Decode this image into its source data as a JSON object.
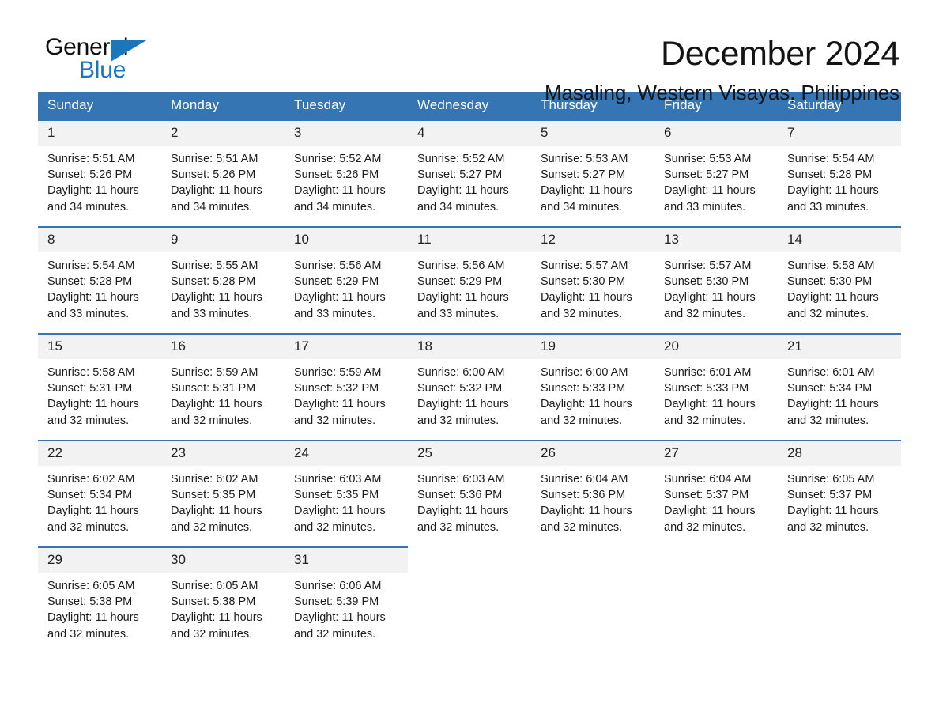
{
  "brand": {
    "name_part1": "General",
    "name_part2": "Blue",
    "triangle_color": "#1b76bc",
    "accent_color": "#3575b4"
  },
  "header": {
    "month_title": "December 2024",
    "location": "Masaling, Western Visayas, Philippines"
  },
  "calendar": {
    "weekday_headers": [
      "Sunday",
      "Monday",
      "Tuesday",
      "Wednesday",
      "Thursday",
      "Friday",
      "Saturday"
    ],
    "weeks": [
      [
        {
          "day": "1",
          "sunrise": "Sunrise: 5:51 AM",
          "sunset": "Sunset: 5:26 PM",
          "daylight": "Daylight: 11 hours and 34 minutes."
        },
        {
          "day": "2",
          "sunrise": "Sunrise: 5:51 AM",
          "sunset": "Sunset: 5:26 PM",
          "daylight": "Daylight: 11 hours and 34 minutes."
        },
        {
          "day": "3",
          "sunrise": "Sunrise: 5:52 AM",
          "sunset": "Sunset: 5:26 PM",
          "daylight": "Daylight: 11 hours and 34 minutes."
        },
        {
          "day": "4",
          "sunrise": "Sunrise: 5:52 AM",
          "sunset": "Sunset: 5:27 PM",
          "daylight": "Daylight: 11 hours and 34 minutes."
        },
        {
          "day": "5",
          "sunrise": "Sunrise: 5:53 AM",
          "sunset": "Sunset: 5:27 PM",
          "daylight": "Daylight: 11 hours and 34 minutes."
        },
        {
          "day": "6",
          "sunrise": "Sunrise: 5:53 AM",
          "sunset": "Sunset: 5:27 PM",
          "daylight": "Daylight: 11 hours and 33 minutes."
        },
        {
          "day": "7",
          "sunrise": "Sunrise: 5:54 AM",
          "sunset": "Sunset: 5:28 PM",
          "daylight": "Daylight: 11 hours and 33 minutes."
        }
      ],
      [
        {
          "day": "8",
          "sunrise": "Sunrise: 5:54 AM",
          "sunset": "Sunset: 5:28 PM",
          "daylight": "Daylight: 11 hours and 33 minutes."
        },
        {
          "day": "9",
          "sunrise": "Sunrise: 5:55 AM",
          "sunset": "Sunset: 5:28 PM",
          "daylight": "Daylight: 11 hours and 33 minutes."
        },
        {
          "day": "10",
          "sunrise": "Sunrise: 5:56 AM",
          "sunset": "Sunset: 5:29 PM",
          "daylight": "Daylight: 11 hours and 33 minutes."
        },
        {
          "day": "11",
          "sunrise": "Sunrise: 5:56 AM",
          "sunset": "Sunset: 5:29 PM",
          "daylight": "Daylight: 11 hours and 33 minutes."
        },
        {
          "day": "12",
          "sunrise": "Sunrise: 5:57 AM",
          "sunset": "Sunset: 5:30 PM",
          "daylight": "Daylight: 11 hours and 32 minutes."
        },
        {
          "day": "13",
          "sunrise": "Sunrise: 5:57 AM",
          "sunset": "Sunset: 5:30 PM",
          "daylight": "Daylight: 11 hours and 32 minutes."
        },
        {
          "day": "14",
          "sunrise": "Sunrise: 5:58 AM",
          "sunset": "Sunset: 5:30 PM",
          "daylight": "Daylight: 11 hours and 32 minutes."
        }
      ],
      [
        {
          "day": "15",
          "sunrise": "Sunrise: 5:58 AM",
          "sunset": "Sunset: 5:31 PM",
          "daylight": "Daylight: 11 hours and 32 minutes."
        },
        {
          "day": "16",
          "sunrise": "Sunrise: 5:59 AM",
          "sunset": "Sunset: 5:31 PM",
          "daylight": "Daylight: 11 hours and 32 minutes."
        },
        {
          "day": "17",
          "sunrise": "Sunrise: 5:59 AM",
          "sunset": "Sunset: 5:32 PM",
          "daylight": "Daylight: 11 hours and 32 minutes."
        },
        {
          "day": "18",
          "sunrise": "Sunrise: 6:00 AM",
          "sunset": "Sunset: 5:32 PM",
          "daylight": "Daylight: 11 hours and 32 minutes."
        },
        {
          "day": "19",
          "sunrise": "Sunrise: 6:00 AM",
          "sunset": "Sunset: 5:33 PM",
          "daylight": "Daylight: 11 hours and 32 minutes."
        },
        {
          "day": "20",
          "sunrise": "Sunrise: 6:01 AM",
          "sunset": "Sunset: 5:33 PM",
          "daylight": "Daylight: 11 hours and 32 minutes."
        },
        {
          "day": "21",
          "sunrise": "Sunrise: 6:01 AM",
          "sunset": "Sunset: 5:34 PM",
          "daylight": "Daylight: 11 hours and 32 minutes."
        }
      ],
      [
        {
          "day": "22",
          "sunrise": "Sunrise: 6:02 AM",
          "sunset": "Sunset: 5:34 PM",
          "daylight": "Daylight: 11 hours and 32 minutes."
        },
        {
          "day": "23",
          "sunrise": "Sunrise: 6:02 AM",
          "sunset": "Sunset: 5:35 PM",
          "daylight": "Daylight: 11 hours and 32 minutes."
        },
        {
          "day": "24",
          "sunrise": "Sunrise: 6:03 AM",
          "sunset": "Sunset: 5:35 PM",
          "daylight": "Daylight: 11 hours and 32 minutes."
        },
        {
          "day": "25",
          "sunrise": "Sunrise: 6:03 AM",
          "sunset": "Sunset: 5:36 PM",
          "daylight": "Daylight: 11 hours and 32 minutes."
        },
        {
          "day": "26",
          "sunrise": "Sunrise: 6:04 AM",
          "sunset": "Sunset: 5:36 PM",
          "daylight": "Daylight: 11 hours and 32 minutes."
        },
        {
          "day": "27",
          "sunrise": "Sunrise: 6:04 AM",
          "sunset": "Sunset: 5:37 PM",
          "daylight": "Daylight: 11 hours and 32 minutes."
        },
        {
          "day": "28",
          "sunrise": "Sunrise: 6:05 AM",
          "sunset": "Sunset: 5:37 PM",
          "daylight": "Daylight: 11 hours and 32 minutes."
        }
      ],
      [
        {
          "day": "29",
          "sunrise": "Sunrise: 6:05 AM",
          "sunset": "Sunset: 5:38 PM",
          "daylight": "Daylight: 11 hours and 32 minutes."
        },
        {
          "day": "30",
          "sunrise": "Sunrise: 6:05 AM",
          "sunset": "Sunset: 5:38 PM",
          "daylight": "Daylight: 11 hours and 32 minutes."
        },
        {
          "day": "31",
          "sunrise": "Sunrise: 6:06 AM",
          "sunset": "Sunset: 5:39 PM",
          "daylight": "Daylight: 11 hours and 32 minutes."
        },
        {
          "day": "",
          "sunrise": "",
          "sunset": "",
          "daylight": ""
        },
        {
          "day": "",
          "sunrise": "",
          "sunset": "",
          "daylight": ""
        },
        {
          "day": "",
          "sunrise": "",
          "sunset": "",
          "daylight": ""
        },
        {
          "day": "",
          "sunrise": "",
          "sunset": "",
          "daylight": ""
        }
      ]
    ]
  }
}
